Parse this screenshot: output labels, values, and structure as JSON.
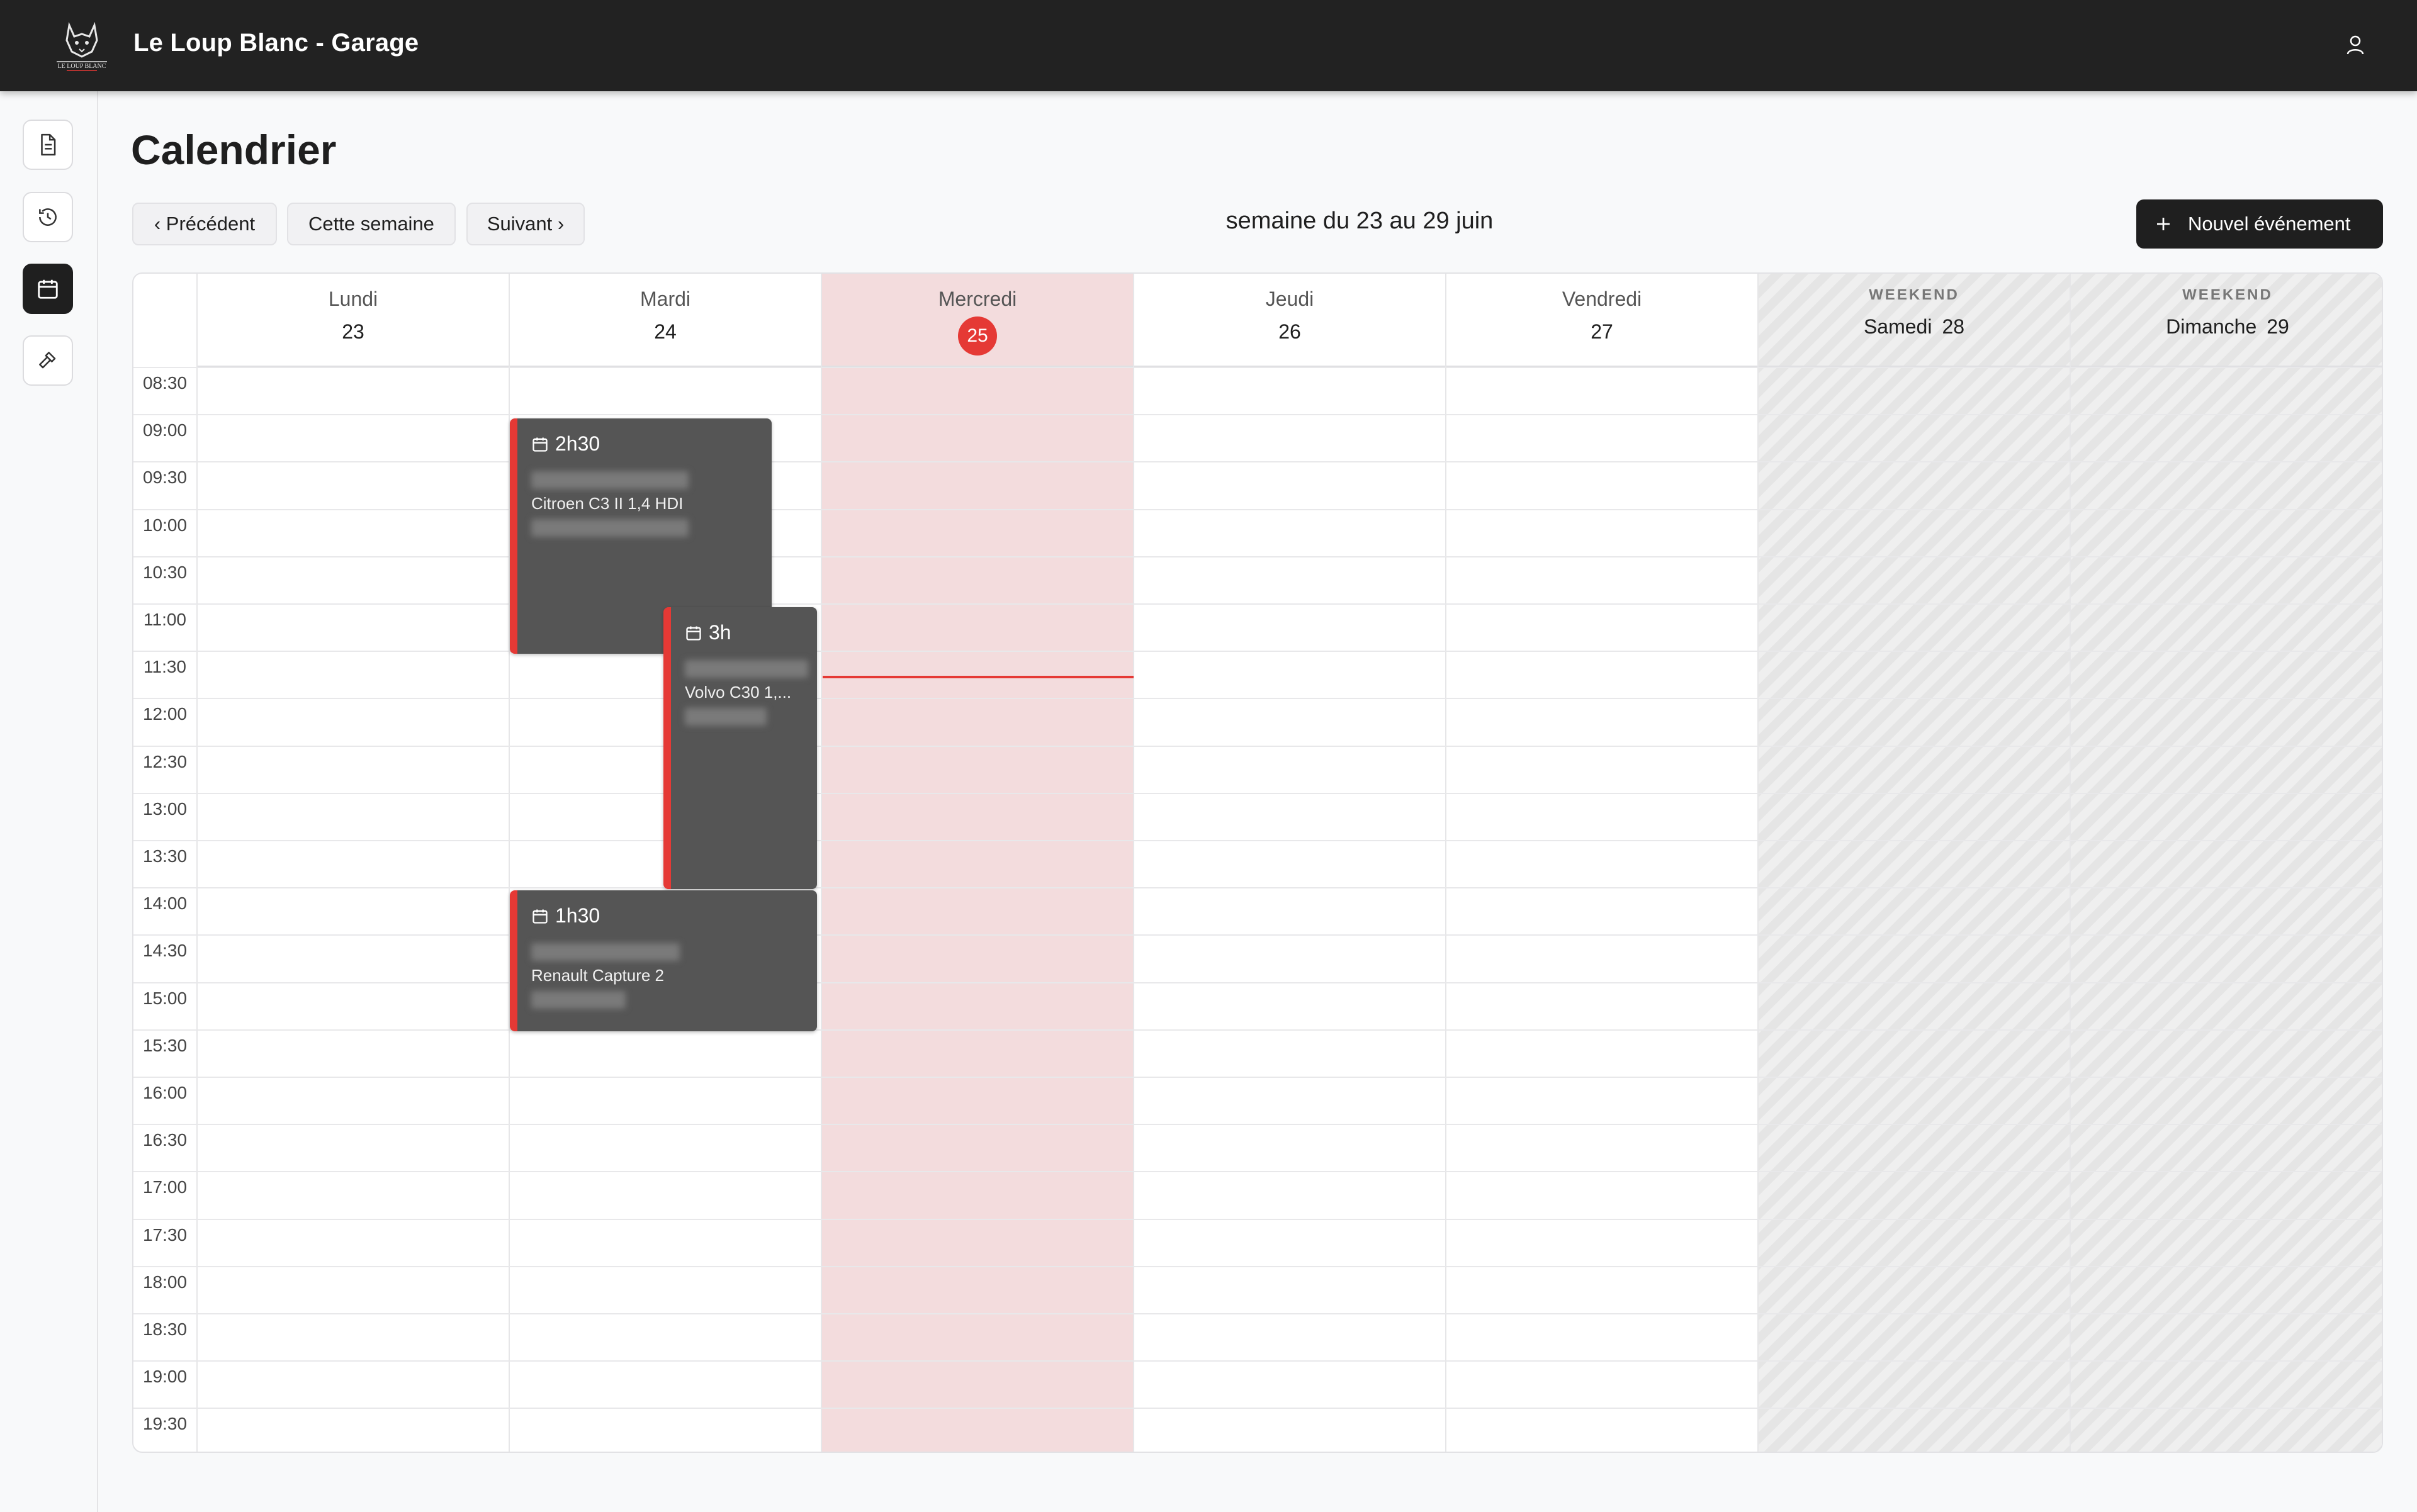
{
  "app": {
    "title": "Le Loup Blanc - Garage",
    "logo_text": "LE LOUP BLANC"
  },
  "sidebar": {
    "items": [
      {
        "icon": "document-icon",
        "active": false
      },
      {
        "icon": "history-icon",
        "active": false
      },
      {
        "icon": "calendar-icon",
        "active": true
      },
      {
        "icon": "tools-icon",
        "active": false
      }
    ]
  },
  "page": {
    "title": "Calendrier",
    "nav": {
      "prev": "‹ Précédent",
      "today": "Cette semaine",
      "next": "Suivant ›"
    },
    "week_label": "semaine du 23 au 29 juin",
    "new_event": "Nouvel événement"
  },
  "calendar": {
    "days": [
      {
        "name": "Lundi",
        "num": "23"
      },
      {
        "name": "Mardi",
        "num": "24"
      },
      {
        "name": "Mercredi",
        "num": "25",
        "today": true
      },
      {
        "name": "Jeudi",
        "num": "26"
      },
      {
        "name": "Vendredi",
        "num": "27"
      },
      {
        "name": "Samedi",
        "num": "28",
        "weekend": true
      },
      {
        "name": "Dimanche",
        "num": "29",
        "weekend": true
      }
    ],
    "weekend_tag": "WEEKEND",
    "times": [
      "08:30",
      "09:00",
      "09:30",
      "10:00",
      "10:30",
      "11:00",
      "11:30",
      "12:00",
      "12:30",
      "13:00",
      "13:30",
      "14:00",
      "14:30",
      "15:00",
      "15:30",
      "16:00",
      "16:30",
      "17:00",
      "17:30",
      "18:00",
      "18:30",
      "19:00",
      "19:30"
    ],
    "events": [
      {
        "duration": "2h30",
        "vehicle": "Citroen C3 II 1,4 HDI"
      },
      {
        "duration": "3h",
        "vehicle": "Volvo C30 1,..."
      },
      {
        "duration": "1h30",
        "vehicle": "Renault Capture 2"
      }
    ],
    "colors": {
      "accent": "#e53935",
      "event_bg": "#555555",
      "today_bg": "#f3dcdd"
    }
  }
}
